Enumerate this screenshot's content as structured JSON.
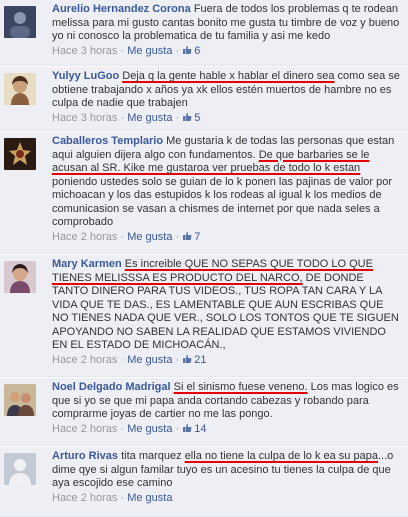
{
  "comments": [
    {
      "name": "Aurelio Hernandez Corona",
      "text": "Fuera de todos los problemas q te rodean melissa para mi gusto cantas bonito me gusta tu timbre de voz y bueno yo ni conosco la problematica de tu familia y asi me kedo",
      "time": "Hace 3 horas",
      "like": "Me gusta",
      "likes": "6",
      "avatar_color": "#4a5a7a"
    },
    {
      "name": "Yulyy LuGoo",
      "text_highlight": "Deja q la gente hable x hablar el dinero sea",
      "text_rest": " como sea se obtiene trabajando x años ya xk ellos estén muertos de hambre no es culpa de nadie que trabajen",
      "time": "Hace 3 horas",
      "like": "Me gusta",
      "likes": "5",
      "avatar_color": "#c9b18a"
    },
    {
      "name": "Caballeros Templario",
      "text_a": "Me gustaria k de todas las personas que estan aqui alguien dijera algo con fundamentos. ",
      "text_highlight": "De que barbaries se le acusan al SR. Kike me gustaroa ver pruebas de todo lo k estan",
      "text_rest": " poniendo ustedes solo se guian de lo k ponen las pajinas de valor por michoacan y los das estupidos k los rodeas al igual k los medios de comunicasion se vasan a chismes de internet por que nada seles a comprobado",
      "time": "Hace 2 horas",
      "like": "Me gusta",
      "likes": "7",
      "avatar_color": "#5a3a2a"
    },
    {
      "name": "Mary Karmen",
      "text_highlight": "Es increible QUE NO SEPAS QUE TODO LO QUE TIENES MELISSSA ES PRODUCTO DEL NARCO,",
      "text_rest": " DE DONDE TANTO DINERO PARA TUS VIDEOS., TUS ROPA TAN CARA Y LA VIDA QUE TE DAS., ES LAMENTABLE QUE AUN ESCRIBAS QUE NO TIENES NADA QUE VER., SOLO LOS TONTOS QUE TE SIGUEN APOYANDO NO SABEN LA REALIDAD QUE ESTAMOS VIVIENDO EN EL ESTADO DE MICHOACÁN.,",
      "time": "Hace 2 horas",
      "like": "Me gusta",
      "likes": "21",
      "avatar_color": "#7a5a6a"
    },
    {
      "name": "Noel Delgado Madrigal",
      "text_highlight": "Si el sinismo fuese veneno.",
      "text_rest": " Los mas logico es que si yo se que mi papa anda cortando cabezas y robando para comprarme joyas de cartier no me las pongo.",
      "time": "Hace 2 horas",
      "like": "Me gusta",
      "likes": "14",
      "avatar_color": "#8a7a5a"
    },
    {
      "name": "Arturo Rivas",
      "text_a": "tita marquez ",
      "text_highlight": "ella no tiene la culpa de lo k ea su papa",
      "text_rest": "...o dime qye si algun familar tuyo es un acesino tu tienes la culpa de que aya escojido ese camino",
      "time": "Hace 2 horas",
      "like": "Me gusta",
      "likes": "",
      "avatar_color": "#b8bcc8"
    }
  ],
  "meta_separator": " · ",
  "colors": {
    "link": "#3b5998",
    "bg": "#edeff4",
    "ink_mark": "#e10000"
  },
  "icons": [
    "thumbs-up-icon",
    "avatar"
  ]
}
